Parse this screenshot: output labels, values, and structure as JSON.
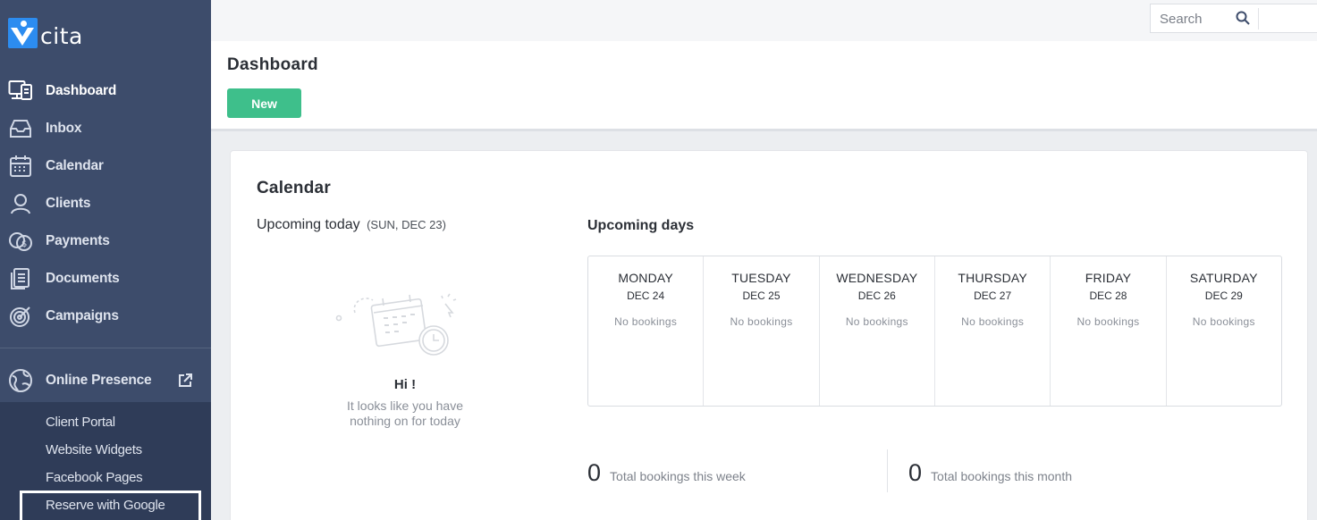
{
  "app": {
    "logo_text": "cita"
  },
  "sidebar": {
    "items": [
      {
        "label": "Dashboard",
        "icon": "dashboard-icon",
        "active": true
      },
      {
        "label": "Inbox",
        "icon": "inbox-icon"
      },
      {
        "label": "Calendar",
        "icon": "calendar-icon"
      },
      {
        "label": "Clients",
        "icon": "clients-icon"
      },
      {
        "label": "Payments",
        "icon": "payments-icon"
      },
      {
        "label": "Documents",
        "icon": "documents-icon"
      },
      {
        "label": "Campaigns",
        "icon": "campaigns-icon"
      }
    ],
    "online_presence": {
      "label": "Online Presence",
      "icon": "globe-icon",
      "sub_items": [
        {
          "label": "Client Portal"
        },
        {
          "label": "Website Widgets"
        },
        {
          "label": "Facebook Pages"
        },
        {
          "label": "Reserve with Google",
          "highlighted": true
        }
      ]
    }
  },
  "topbar": {
    "search_placeholder": "Search"
  },
  "header": {
    "title": "Dashboard",
    "new_button": "New"
  },
  "calendar_card": {
    "title": "Calendar",
    "today": {
      "title": "Upcoming today",
      "date": "(SUN,  DEC 23)",
      "empty_title": "Hi !",
      "empty_text": "It looks like you have nothing on for today"
    },
    "upcoming": {
      "title": "Upcoming days",
      "days": [
        {
          "name": "MONDAY",
          "date": "DEC 24",
          "status": "No bookings"
        },
        {
          "name": "TUESDAY",
          "date": "DEC 25",
          "status": "No bookings"
        },
        {
          "name": "WEDNESDAY",
          "date": "DEC 26",
          "status": "No bookings"
        },
        {
          "name": "THURSDAY",
          "date": "DEC 27",
          "status": "No bookings"
        },
        {
          "name": "FRIDAY",
          "date": "DEC 28",
          "status": "No bookings"
        },
        {
          "name": "SATURDAY",
          "date": "DEC 29",
          "status": "No bookings"
        }
      ]
    },
    "stats": {
      "week": {
        "value": "0",
        "label": "Total bookings this week"
      },
      "month": {
        "value": "0",
        "label": "Total bookings this month"
      }
    }
  },
  "colors": {
    "sidebar_bg": "#3d4c6b",
    "sidebar_sub_bg": "#2f3c58",
    "accent_green": "#3ebf8b",
    "logo_blue": "#2c8cf0"
  }
}
